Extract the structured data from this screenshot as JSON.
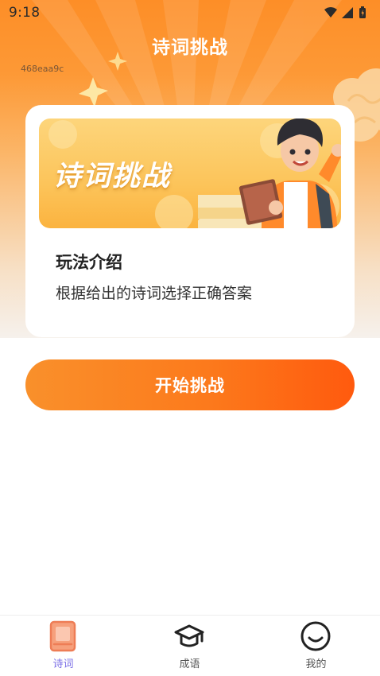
{
  "status_bar": {
    "time": "9:18",
    "icons": [
      "wifi-icon",
      "cellular-signal-icon",
      "battery-icon"
    ]
  },
  "header": {
    "title": "诗词挑战",
    "device_id": "468eaa9c"
  },
  "card": {
    "banner_text": "诗词挑战",
    "intro_title": "玩法介绍",
    "intro_description": "根据给出的诗词选择正确答案"
  },
  "start_button": {
    "label": "开始挑战"
  },
  "tab_bar": {
    "tabs": [
      {
        "label": "诗词",
        "icon": "book-icon",
        "active": true
      },
      {
        "label": "成语",
        "icon": "graduation-cap-icon",
        "active": false
      },
      {
        "label": "我的",
        "icon": "smiley-face-icon",
        "active": false
      }
    ]
  },
  "colors": {
    "primary_orange": "#fc7a1c",
    "active_tab": "#7a6ee6",
    "banner_yellow": "#fcc45a"
  }
}
